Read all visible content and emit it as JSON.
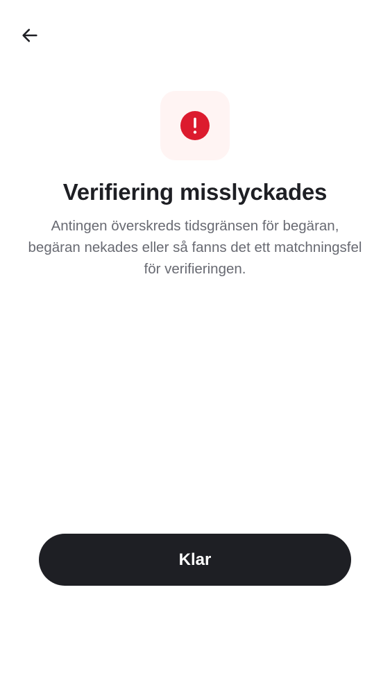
{
  "header": {
    "back_icon": "arrow-left-icon"
  },
  "status": {
    "icon": "error-exclamation-icon",
    "icon_color": "#dc1b2e",
    "tile_color": "#fff4f3"
  },
  "content": {
    "title": "Verifiering misslyckades",
    "description": "Antingen överskreds tidsgränsen för begäran, begäran nekades eller så fanns det ett matchningsfel för verifieringen."
  },
  "actions": {
    "done_label": "Klar",
    "button_color": "#1e1f24"
  }
}
